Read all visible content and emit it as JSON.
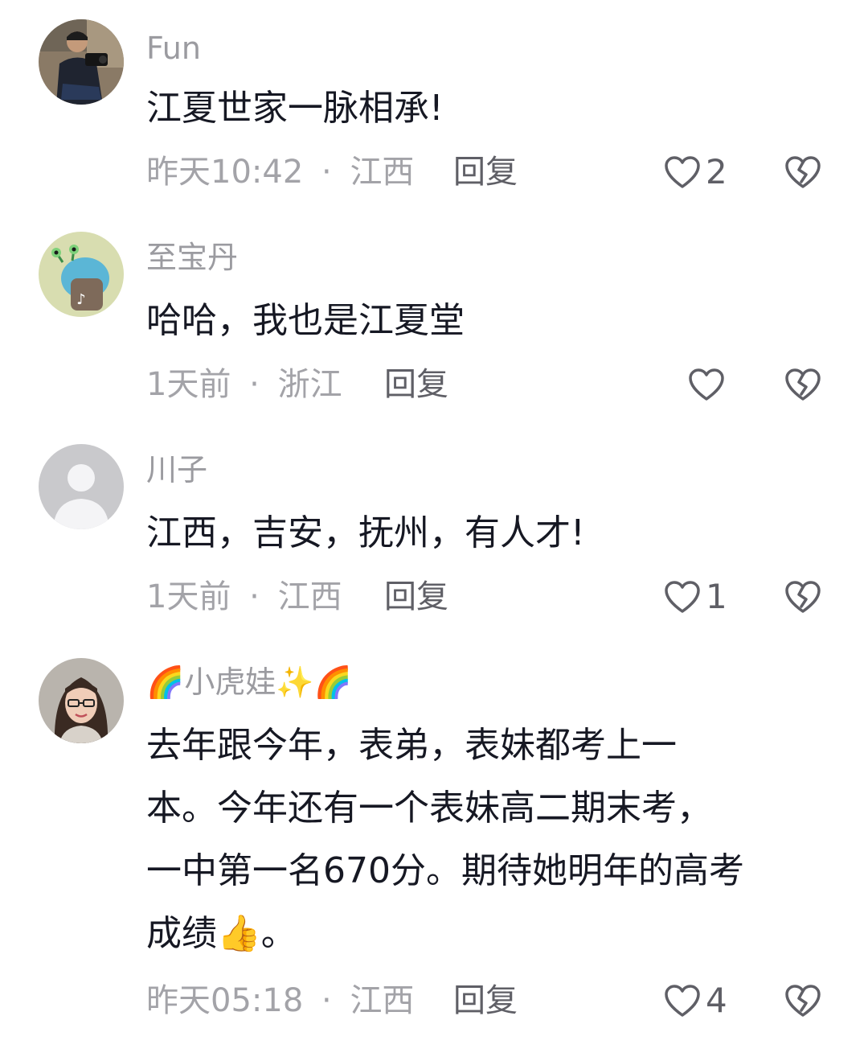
{
  "comments": [
    {
      "username": "Fun",
      "text": "江夏世家一脉相承!",
      "time": "昨天10:42",
      "location": "江西",
      "reply_label": "回复",
      "likes": "2",
      "avatar": "photo-man-crouching"
    },
    {
      "username": "至宝丹",
      "text": "哈哈，我也是江夏堂",
      "time": "1天前",
      "location": "浙江",
      "reply_label": "回复",
      "likes": "",
      "avatar": "cartoon-snail-tiktok"
    },
    {
      "username": "川子",
      "text": "江西，吉安，抚州，有人才!",
      "time": "1天前",
      "location": "江西",
      "reply_label": "回复",
      "likes": "1",
      "avatar": "default-user-icon"
    },
    {
      "username": "小虎娃",
      "username_prefix_emoji": "🌈",
      "username_suffix_emoji": "✨🌈",
      "text_lines": [
        "去年跟今年，表弟，表妹都考上一",
        "本。今年还有一个表妹高二期末考，",
        "一中第一名670分。期待她明年的高考",
        "成绩"
      ],
      "text_tail_emoji": "👍",
      "text_tail": "。",
      "time": "昨天05:18",
      "location": "江西",
      "reply_label": "回复",
      "likes": "4",
      "avatar": "photo-woman-glasses"
    }
  ],
  "separator": "·",
  "icons": {
    "like": "heart-outline-icon",
    "dislike": "broken-heart-icon"
  },
  "colors": {
    "text": "#161823",
    "meta": "#a3a3a8",
    "username": "#9b9ba0"
  }
}
